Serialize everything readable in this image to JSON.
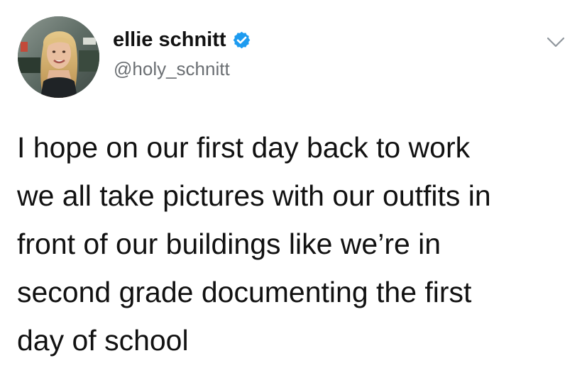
{
  "author": {
    "display_name": "ellie schnitt",
    "handle": "@holy_schnitt",
    "verified": true,
    "avatar_icon": "profile-photo-avatar",
    "verified_icon": "verified-check-icon"
  },
  "actions": {
    "more_icon": "chevron-down-icon"
  },
  "tweet": {
    "lines": [
      "I hope on our first day back to work",
      "we all take pictures with our outfits in",
      "front of our buildings like we’re in",
      "second grade documenting the first",
      "day of school"
    ]
  },
  "colors": {
    "text": "#111111",
    "handle": "#6b6f73",
    "verified_blue": "#1d9bf0",
    "chevron": "#8f969c",
    "background": "#ffffff"
  }
}
